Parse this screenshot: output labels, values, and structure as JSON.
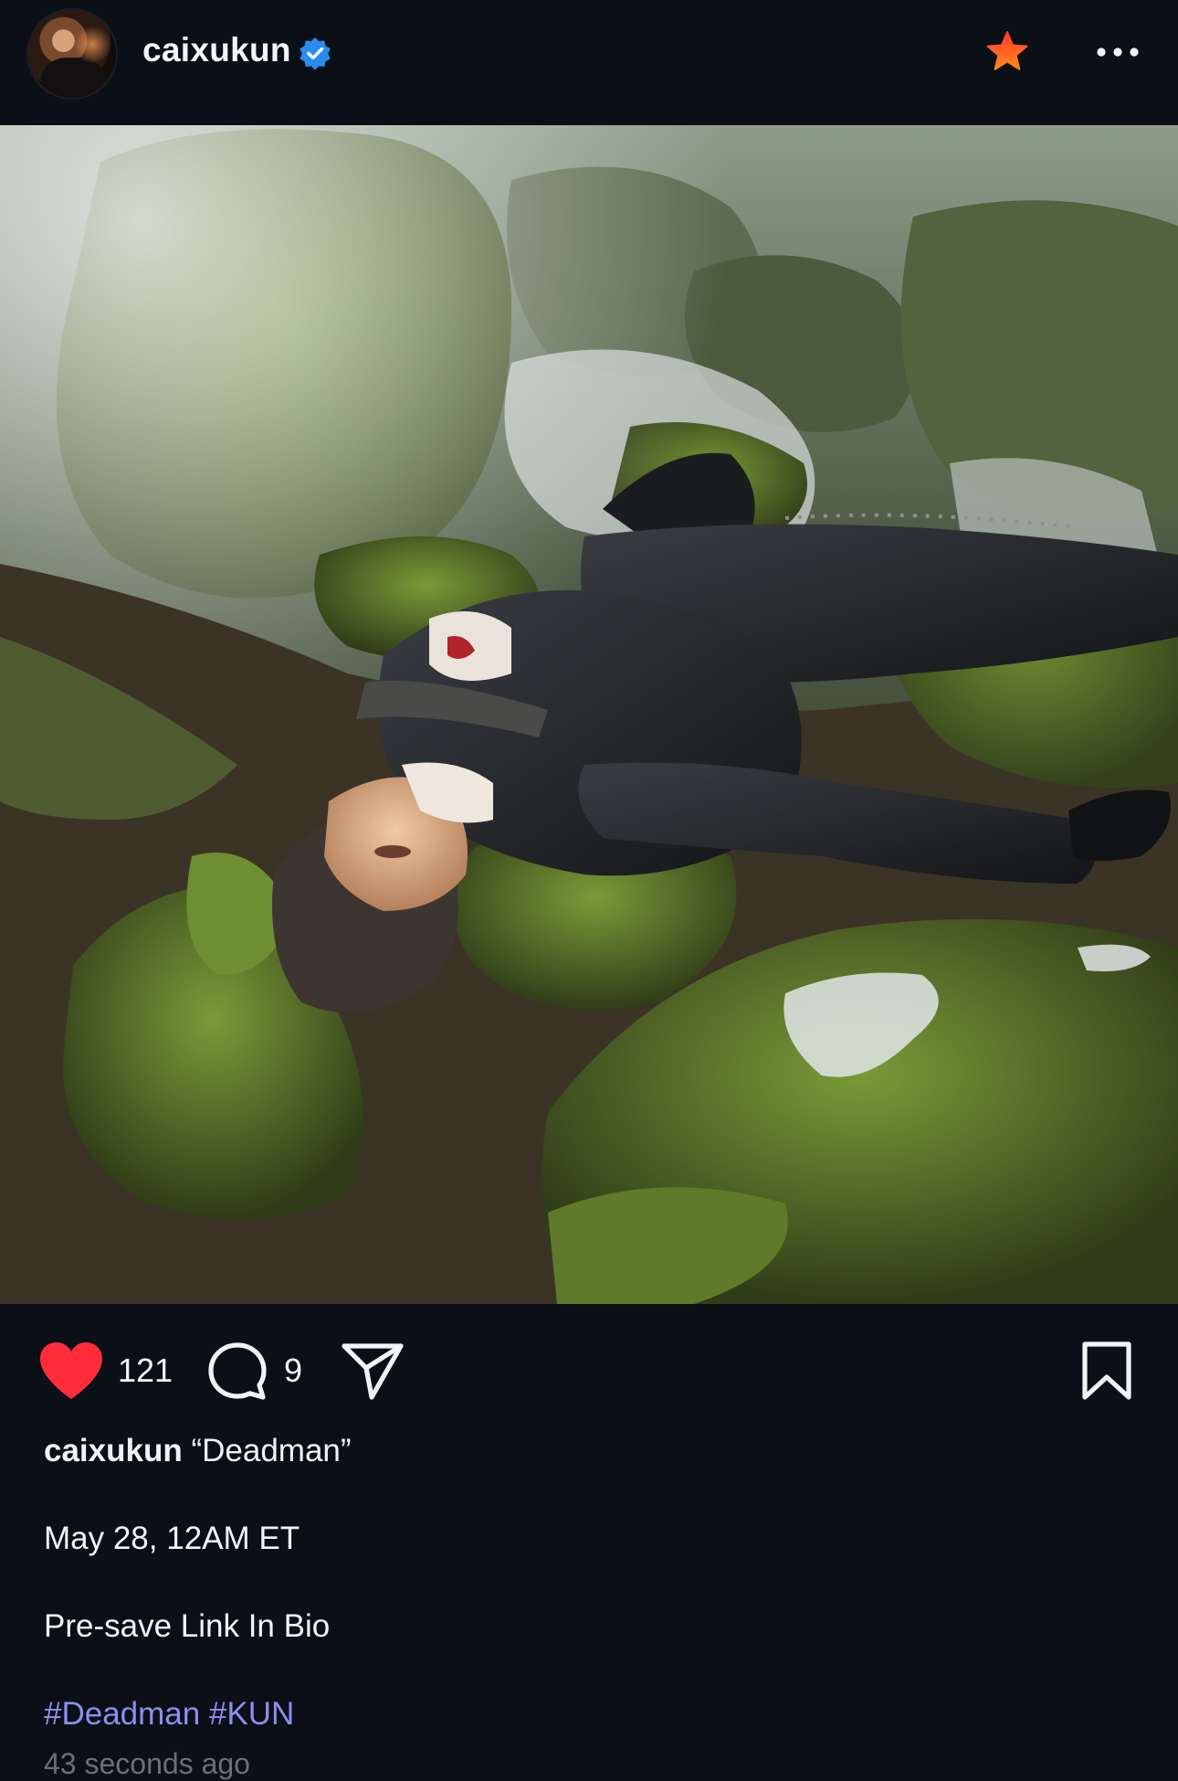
{
  "header": {
    "username": "caixukun",
    "verified": true,
    "icons": {
      "avatar": "profile-avatar",
      "verified": "verified-badge-icon",
      "favorite": "star-icon",
      "more": "more-horizontal-icon"
    },
    "colors": {
      "verified": "#2a8cf0",
      "star": "#ff5a1f"
    }
  },
  "post": {
    "image_alt_name": "post-photo"
  },
  "actions": {
    "like_count": "121",
    "comment_count": "9",
    "liked": true,
    "icons": {
      "like": "heart-filled-icon",
      "comment": "comment-bubble-icon",
      "share": "paper-plane-icon",
      "save": "bookmark-icon"
    },
    "colors": {
      "like": "#ff2d3b"
    }
  },
  "caption": {
    "author": "caixukun",
    "title": " “Deadman”",
    "line2": "May 28, 12AM ET",
    "line3": "Pre-save Link In Bio",
    "hashtags": [
      "#Deadman",
      "#KUN"
    ],
    "timestamp": "43 seconds ago",
    "colors": {
      "hashtag": "#8c8ff0"
    }
  }
}
